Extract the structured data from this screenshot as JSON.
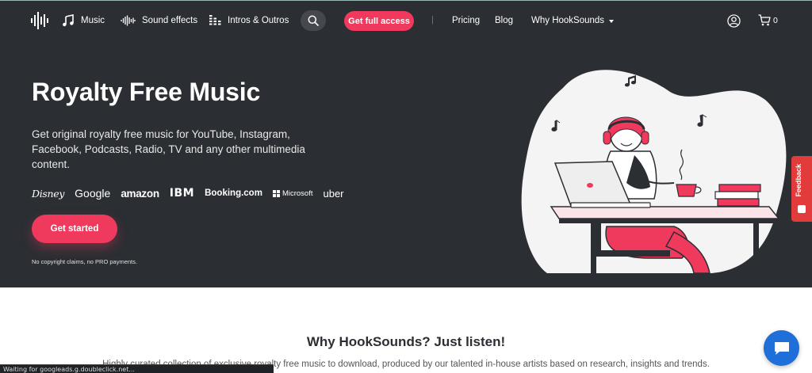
{
  "nav": {
    "items": [
      {
        "label": "Music",
        "icon": "music-note-icon"
      },
      {
        "label": "Sound effects",
        "icon": "waveform-icon"
      },
      {
        "label": "Intros & Outros",
        "icon": "equalizer-icon"
      }
    ],
    "cta_label": "Get full access",
    "separator": "|",
    "links": [
      "Pricing",
      "Blog",
      "Why HookSounds"
    ],
    "cart_count": "0"
  },
  "hero": {
    "title": "Royalty Free Music",
    "subtitle": "Get original royalty free music for YouTube, Instagram, Facebook, Podcasts, Radio, TV and any other multimedia content.",
    "brands": [
      "Disney",
      "Google",
      "amazon",
      "IBM",
      "Booking.com",
      "Microsoft",
      "Uber"
    ],
    "cta_label": "Get started",
    "note": "No copyright claims, no PRO payments."
  },
  "feedback": {
    "label": "Feedback"
  },
  "section": {
    "title": "Why HookSounds? Just listen!",
    "text": "Highly curated collection of exclusive royalty free music to download, produced by our talented in-house artists based on research, insights and trends."
  },
  "status_bar": {
    "text": "Waiting for googleads.g.doubleclick.net..."
  },
  "colors": {
    "accent": "#ef3a5d",
    "hero_bg": "#2b2e33",
    "chat": "#1e6fd9",
    "feedback": "#e13b3b"
  }
}
